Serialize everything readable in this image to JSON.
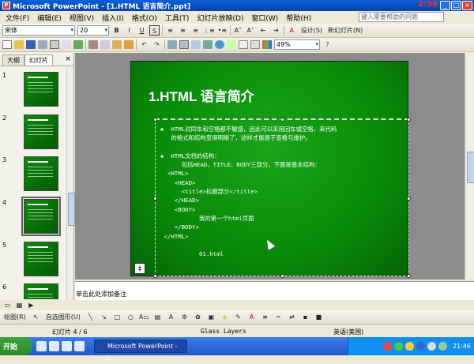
{
  "window": {
    "title": "Microsoft PowerPoint - [1.HTML 语言简介.ppt]",
    "overlay_time": "2:56"
  },
  "menu": [
    "文件(F)",
    "编辑(E)",
    "视图(V)",
    "插入(I)",
    "格式(O)",
    "工具(T)",
    "幻灯片放映(D)",
    "窗口(W)",
    "帮助(H)"
  ],
  "help_placeholder": "键入需要帮助的问题",
  "format_toolbar": {
    "font": "宋体",
    "size": "20",
    "design": "设计(S)",
    "new_slide": "新幻灯片(N)"
  },
  "standard_toolbar": {
    "zoom": "49%"
  },
  "outline_tabs": [
    "大纲",
    "幻灯片"
  ],
  "thumbnails": [
    1,
    2,
    3,
    4,
    5,
    6
  ],
  "selected_slide": 4,
  "slide": {
    "title": "1.HTML 语言简介",
    "body": "▪  HTML对同车和空格都不敏感，因此可以采用回车或空格，来代码\n   的格式和结构变得明晰了，这样才能易于查看与维护。\n\n▪  HTML文档的结构：\n      包括HEAD、TITLE、BODY三部分，下面是基本结构：\n  <HTML>\n    <HEAD>\n      <title>标题部分</title>\n    </HEAD>\n    <BODY>\n           我的第一个html页面\n    </BODY>\n </HTML>\n\n           01.html"
  },
  "notes_placeholder": "单击此处添加备注",
  "drawing": {
    "draw": "绘图(R)",
    "autoshapes": "自选图形(U)"
  },
  "status": {
    "slide_info": "幻灯片 4 / 6",
    "design": "Glass Layers",
    "language": "英语(美国)"
  },
  "taskbar": {
    "start": "开始",
    "task": "Microsoft PowerPoint - [...",
    "time": "21:46"
  }
}
